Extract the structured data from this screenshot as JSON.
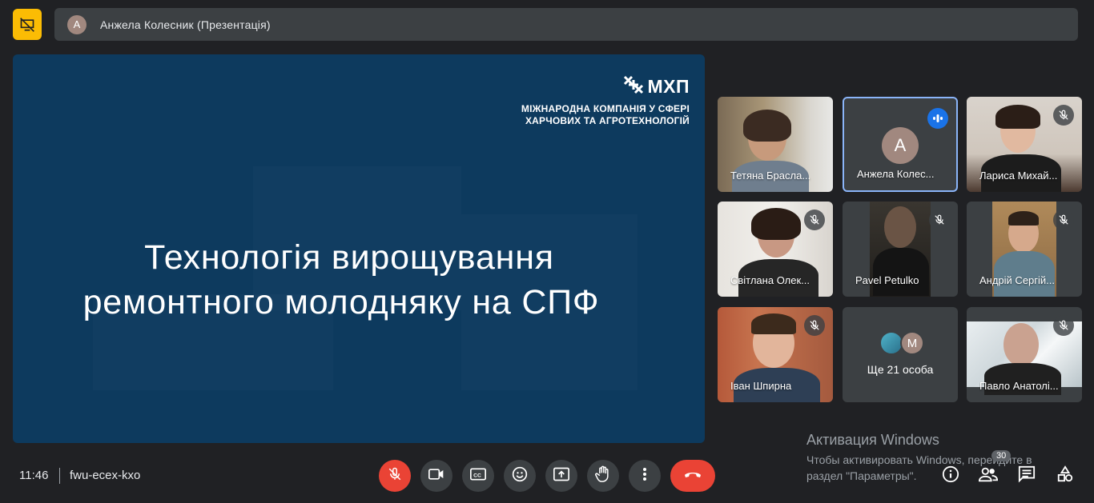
{
  "presenter_bar": {
    "avatar_letter": "А",
    "label": "Анжела Колесник (Презентація)"
  },
  "slide": {
    "brand_name": "МХП",
    "brand_line1": "МІЖНАРОДНА КОМПАНІЯ У СФЕРІ",
    "brand_line2": "ХАРЧОВИХ ТА АГРОТЕХНОЛОГІЙ",
    "title_line1": "Технологія вирощування",
    "title_line2": "ремонтного молодняку на СПФ"
  },
  "participants": [
    {
      "name": "Тетяна Брасла...",
      "muted": false
    },
    {
      "name": "Анжела Колес...",
      "avatar_letter": "А",
      "speaking": true
    },
    {
      "name": "Лариса Михай...",
      "muted": true
    },
    {
      "name": "Світлана Олек...",
      "muted": true
    },
    {
      "name": "Pavel Petulko",
      "muted": true
    },
    {
      "name": "Андрій Сергій...",
      "muted": true
    },
    {
      "name": "Іван Шпирна",
      "muted": true
    },
    {
      "more_label": "Ще 21 особа",
      "avatar_letter": "M"
    },
    {
      "name": "Павло Анатолі...",
      "muted": true
    }
  ],
  "meeting": {
    "time": "11:46",
    "code": "fwu-ecex-kxo"
  },
  "activation": {
    "title": "Активация Windows",
    "text": "Чтобы активировать Windows, перейдите в раздел \"Параметры\"."
  },
  "people_count": "30",
  "colors": {
    "accent": "#8ab4f8",
    "danger": "#ea4335",
    "warning": "#fbbc04",
    "slide_bg": "#0d3a5e"
  }
}
